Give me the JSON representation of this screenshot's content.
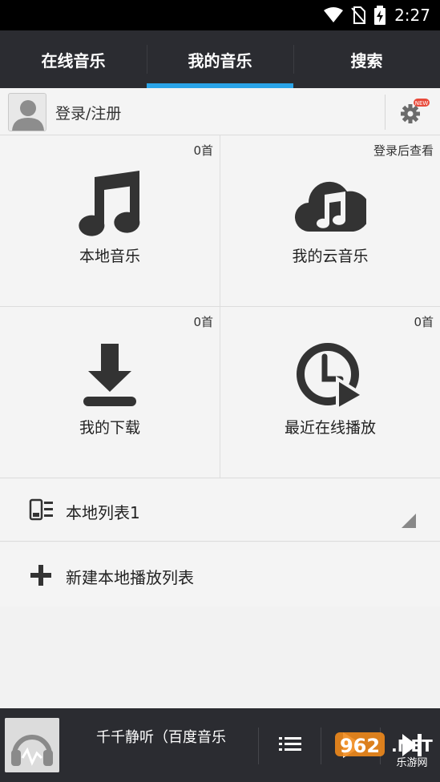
{
  "status_bar": {
    "time": "2:27",
    "icons": [
      "wifi-icon",
      "no-sim-icon",
      "battery-charging-icon"
    ]
  },
  "tabs": [
    {
      "label": "在线音乐",
      "active": false
    },
    {
      "label": "我的音乐",
      "active": true
    },
    {
      "label": "搜索",
      "active": false
    }
  ],
  "login": {
    "label": "登录/注册",
    "settings_badge": "NEW"
  },
  "grid": [
    {
      "title": "本地音乐",
      "count": "0首",
      "icon": "music-note-icon"
    },
    {
      "title": "我的云音乐",
      "count": "登录后查看",
      "icon": "cloud-music-icon"
    },
    {
      "title": "我的下载",
      "count": "0首",
      "icon": "download-icon"
    },
    {
      "title": "最近在线播放",
      "count": "0首",
      "icon": "recent-play-icon"
    }
  ],
  "playlist": {
    "label": "本地列表1"
  },
  "new_playlist": {
    "label": "新建本地播放列表"
  },
  "player": {
    "song_title": "千千静听（百度音乐",
    "watermark": "962.NET 乐游网"
  },
  "colors": {
    "tab_bar": "#2b2c31",
    "active_indicator": "#2aa4e8",
    "badge": "#e84a3a",
    "icon_dark": "#333333"
  }
}
